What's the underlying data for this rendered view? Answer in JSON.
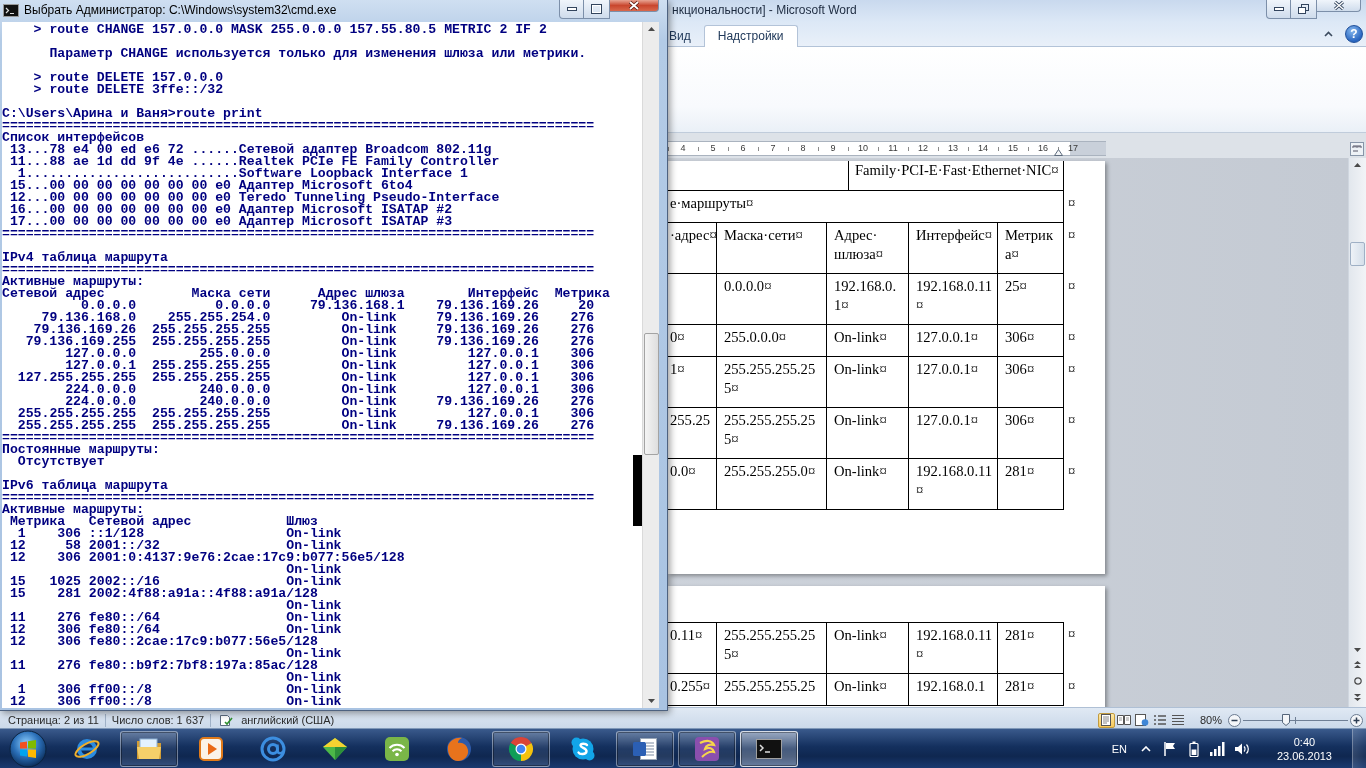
{
  "console_window": {
    "title": "Выбрать Администратор: C:\\Windows\\system32\\cmd.exe",
    "blocks": [
      [
        "    > route CHANGE 157.0.0.0 MASK 255.0.0.0 157.55.80.5 METRIC 2 IF 2"
      ],
      [
        "      Параметр CHANGE используется только для изменения шлюза или метрики."
      ],
      [
        "    > route DELETE 157.0.0.0",
        "    > route DELETE 3ffe::/32"
      ],
      [
        "C:\\Users\\Арина и Ваня>route print",
        "===========================================================================",
        "Список интерфейсов",
        " 13...78 e4 00 ed e6 72 ......Сетевой адаптер Broadcom 802.11g",
        " 11...88 ae 1d dd 9f 4e ......Realtek PCIe FE Family Controller",
        "  1...........................Software Loopback Interface 1",
        " 15...00 00 00 00 00 00 00 e0 Адаптер Microsoft 6to4",
        " 12...00 00 00 00 00 00 00 e0 Teredo Tunneling Pseudo-Interface",
        " 16...00 00 00 00 00 00 00 e0 Адаптер Microsoft ISATAP #2",
        " 17...00 00 00 00 00 00 00 e0 Адаптер Microsoft ISATAP #3",
        "==========================================================================="
      ],
      [
        "IPv4 таблица маршрута",
        "===========================================================================",
        "Активные маршруты:",
        "Сетевой адрес           Маска сети      Адрес шлюза        Интерфейс  Метрика",
        "          0.0.0.0          0.0.0.0     79.136.168.1    79.136.169.26     20",
        "     79.136.168.0    255.255.254.0         On-link     79.136.169.26    276",
        "    79.136.169.26  255.255.255.255         On-link     79.136.169.26    276",
        "   79.136.169.255  255.255.255.255         On-link     79.136.169.26    276",
        "        127.0.0.0        255.0.0.0         On-link         127.0.0.1    306",
        "        127.0.0.1  255.255.255.255         On-link         127.0.0.1    306",
        "  127.255.255.255  255.255.255.255         On-link         127.0.0.1    306",
        "        224.0.0.0        240.0.0.0         On-link         127.0.0.1    306",
        "        224.0.0.0        240.0.0.0         On-link     79.136.169.26    276",
        "  255.255.255.255  255.255.255.255         On-link         127.0.0.1    306",
        "  255.255.255.255  255.255.255.255         On-link     79.136.169.26    276",
        "===========================================================================",
        "Постоянные маршруты:",
        "  Отсутствует"
      ],
      [
        "IPv6 таблица маршрута",
        "===========================================================================",
        "Активные маршруты:",
        " Метрика   Сетевой адрес            Шлюз",
        "  1    306 ::1/128                  On-link",
        " 12     58 2001::/32                On-link",
        " 12    306 2001:0:4137:9e76:2cae:17c9:b077:56e5/128",
        "                                    On-link",
        " 15   1025 2002::/16                On-link",
        " 15    281 2002:4f88:a91a::4f88:a91a/128",
        "                                    On-link",
        " 11    276 fe80::/64                On-link",
        " 12    306 fe80::/64                On-link",
        " 12    306 fe80::2cae:17c9:b077:56e5/128",
        "                                    On-link",
        " 11    276 fe80::b9f2:7bf8:197a:85ac/128",
        "                                    On-link",
        "  1    306 ff00::/8                 On-link",
        " 12    306 ff00::/8                 On-link"
      ]
    ]
  },
  "word_window": {
    "title": "нкциональности] - Microsoft Word",
    "ribbon_tabs": [
      {
        "label": "Вид",
        "selected": false
      },
      {
        "label": "Надстройки",
        "selected": true
      }
    ],
    "help_button": "?",
    "ruler": [
      "4",
      "5",
      "6",
      "7",
      "8",
      "9",
      "10",
      "11",
      "12",
      "13",
      "14",
      "15",
      "16",
      "17"
    ],
    "pages": [
      {
        "rows": [
          {
            "kind": "split",
            "right_cell": "Family·PCI-E·Fast·Ethernet·NIC¤"
          },
          {
            "kind": "merged",
            "text": "е·маршруты¤",
            "end_mark": "¤"
          },
          {
            "kind": "cells",
            "column_1": "·адрес¤",
            "column_2": "Маска·сети¤",
            "column_3": "Адрес·шлюза¤",
            "column_4": "Интерфейс¤",
            "column_5": "Метрика¤",
            "end_mark": "¤"
          },
          {
            "kind": "cells",
            "column_2": "0.0.0.0¤",
            "column_3": "192.168.0.1¤",
            "column_4": "192.168.0.11¤",
            "column_5": "25¤",
            "end_mark": "¤"
          },
          {
            "kind": "cells",
            "column_1": "0¤",
            "column_2": "255.0.0.0¤",
            "column_3": "On-link¤",
            "column_4": "127.0.0.1¤",
            "column_5": "306¤",
            "end_mark": "¤"
          },
          {
            "kind": "cells",
            "column_1": "1¤",
            "column_2": "255.255.255.255¤",
            "column_3": "On-link¤",
            "column_4": "127.0.0.1¤",
            "column_5": "306¤",
            "end_mark": "¤"
          },
          {
            "kind": "cells",
            "column_1": "255.25",
            "column_2": "255.255.255.255¤",
            "column_3": "On-link¤",
            "column_4": "127.0.0.1¤",
            "column_5": "306¤",
            "end_mark": "¤"
          },
          {
            "kind": "cells",
            "column_1": "0.0¤",
            "column_2": "255.255.255.0¤",
            "column_3": "On-link¤",
            "column_4": "192.168.0.11¤",
            "column_5": "281¤",
            "end_mark": "¤"
          }
        ]
      },
      {
        "rows": [
          {
            "kind": "cells",
            "column_1": "0.11¤",
            "column_2": "255.255.255.255¤",
            "column_3": "On-link¤",
            "column_4": "192.168.0.11¤",
            "column_5": "281¤",
            "end_mark": "¤"
          },
          {
            "kind": "cells",
            "column_1": "0.255¤",
            "column_2": "255.255.255.25",
            "column_3": "On-link¤",
            "column_4": "192.168.0.1",
            "column_5": "281¤",
            "end_mark": "¤"
          }
        ]
      }
    ],
    "status_bar": {
      "page": "Страница: 2 из 11",
      "words": "Число слов: 1 637",
      "language": "английский (США)",
      "views": [
        {
          "kind": "print_layout",
          "selected": true
        },
        {
          "kind": "full_screen_reading",
          "selected": false
        },
        {
          "kind": "web_layout",
          "selected": false
        },
        {
          "kind": "outline",
          "selected": false
        },
        {
          "kind": "draft",
          "selected": false
        }
      ],
      "zoom": "80%",
      "zoom_slider": {
        "level": 0.41
      }
    }
  },
  "taskbar": {
    "apps": [
      {
        "kind": "e_browser",
        "running": false,
        "selected": false
      },
      {
        "kind": "folder",
        "running": true,
        "selected": false
      },
      {
        "kind": "player",
        "running": false,
        "selected": false
      },
      {
        "kind": "at_sign",
        "running": false,
        "selected": false
      },
      {
        "kind": "gem",
        "running": false,
        "selected": false
      },
      {
        "kind": "wifi",
        "running": false,
        "selected": false
      },
      {
        "kind": "fox",
        "running": false,
        "selected": false
      },
      {
        "kind": "wheel",
        "running": true,
        "selected": false
      },
      {
        "kind": "s_bubble",
        "running": false,
        "selected": false
      },
      {
        "kind": "w_document",
        "running": true,
        "selected": false
      },
      {
        "kind": "ribbon",
        "running": true,
        "selected": false
      },
      {
        "kind": "terminal",
        "running": true,
        "selected": true
      }
    ],
    "tray": {
      "language": "EN",
      "time": "0:40",
      "date": "23.06.2013"
    }
  }
}
